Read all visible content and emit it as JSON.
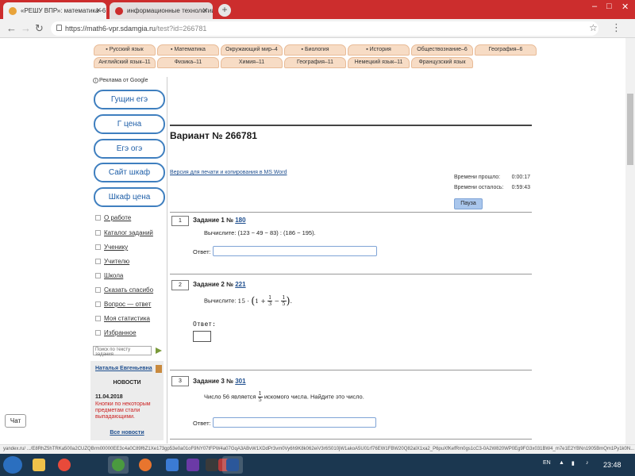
{
  "browser": {
    "tabs": [
      {
        "label": "«РЕШУ ВПР»: математика–6. ВПР",
        "favicon_color": "#e8a33a"
      },
      {
        "label": "информационные технологии на",
        "favicon_color": "#cc2d2d"
      }
    ],
    "new_tab": "+",
    "window_controls": {
      "minimize": "–",
      "maximize": "□",
      "close": "✕"
    },
    "url_domain": "https://math6-vpr.sdamgia.ru",
    "url_path": "/test?id=266781",
    "accent": "#cc2d2d"
  },
  "subjects_row1": [
    "Русский язык",
    "Математика",
    "Окружающий мир–4",
    "Биология",
    "История",
    "Обществознание–6",
    "География–6"
  ],
  "subjects_row2": [
    "Английский язык–11",
    "Физика–11",
    "Химия–11",
    "География–11",
    "Немецкий язык–11",
    "Французский язык"
  ],
  "sidebar": {
    "ads_label": "Реклама от Google",
    "ad_buttons": [
      "Гущин егэ",
      "Г цена",
      "Егэ огэ",
      "Сайт шкаф",
      "Шкаф цена"
    ],
    "links": [
      "О работе",
      "Каталог заданий",
      "Ученику",
      "Учителю",
      "Школа",
      "Сказать спасибо",
      "Вопрос — ответ",
      "Моя статистика",
      "Избранное"
    ],
    "search_placeholder": "Поиск по тексту задания",
    "user_name": "Наталья Евгеньевна",
    "news_heading": "НОВОСТИ",
    "news_date": "11.04.2018",
    "news_text": "Кнопки по некоторым предметам стали выпадающими.",
    "all_news": "Все новости"
  },
  "main": {
    "variant_title": "Вариант № 266781",
    "print_link": "Версия для печати и копирования в MS Word",
    "time_passed_label": "Времени прошло:",
    "time_passed": "0:00:17",
    "time_left_label": "Времени осталось:",
    "time_left": "0:59:43",
    "pause_label": "Пауза",
    "answer_label": "Ответ:",
    "tasks": [
      {
        "num": "1",
        "title": "Задание 1 №",
        "ref": "180",
        "text": "Вычислите: (123 − 49 − 83) : (186 − 195)."
      },
      {
        "num": "2",
        "title": "Задание 2 №",
        "ref": "221",
        "text_prefix": "Вычислите:",
        "expr_lead": "15 ·",
        "expr_one": "1 +",
        "frac1_n": "1",
        "frac1_d": "3",
        "minus": "−",
        "frac2_n": "1",
        "frac2_d": "5"
      },
      {
        "num": "3",
        "title": "Задание 3 №",
        "ref": "301",
        "text_prefix": "Число 56 является",
        "frac_n": "1",
        "frac_d": "5",
        "text_suffix": "искомого числа. Найдите это число."
      }
    ]
  },
  "chat_label": "Чат",
  "statusbar_text": "yandex.ru/ .../E8RhZ5hTRKa500a2CUZQBrm00000EE3c4a0C89f6Z1Xe173gp53e0a01oF9NY07tFPW4a07GqA3ABvW1XDdPr3vm0Vy6h9K8k062eiV3r6S010jW1akoA5U01rf76EW1FBW20Q82alX1xa2_P6puXfKefRm0gs1cC3-0A2W820WP0Eg9FG3x031BW4_m7e1E2YBNn1905BmQm1Py1k0N...",
  "taskbar": {
    "icons": [
      {
        "name": "explorer-icon",
        "color": "#f0c24a"
      },
      {
        "name": "yandex-browser-icon",
        "color": "#e84a3a"
      },
      {
        "name": "chrome-icon",
        "color": "#4a9a3f"
      },
      {
        "name": "firefox-icon",
        "color": "#e8752e"
      },
      {
        "name": "mail-icon",
        "color": "#3b7bd4"
      },
      {
        "name": "media-icon",
        "color": "#6b3aa6"
      },
      {
        "name": "media-player-icon",
        "color": "#3a3a3a"
      },
      {
        "name": "video-icon",
        "color": "#b23a3a"
      },
      {
        "name": "word-icon",
        "color": "#2b579a"
      }
    ],
    "language": "EN",
    "time": "23:48"
  }
}
